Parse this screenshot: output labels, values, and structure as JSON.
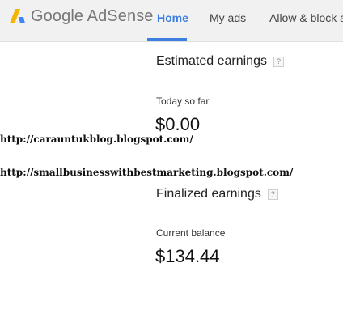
{
  "header": {
    "brand_name": "Google AdSense",
    "tabs": [
      {
        "label": "Home"
      },
      {
        "label": "My ads"
      },
      {
        "label": "Allow & block a"
      }
    ]
  },
  "estimated": {
    "title": "Estimated earnings",
    "help": "?",
    "today_label": "Today so far",
    "today_value": "$0.00"
  },
  "finalized": {
    "title": "Finalized earnings",
    "help": "?",
    "balance_label": "Current balance",
    "balance_value": "$134.44"
  },
  "overlay": {
    "url_1": "http://carauntukblog.blogspot.com/",
    "url_2": "http://smallbusinesswithbestmarketing.blogspot.com/"
  },
  "colors": {
    "accent": "#3d7ee0",
    "logo_yellow": "#f4b400",
    "logo_blue": "#4285f4"
  }
}
